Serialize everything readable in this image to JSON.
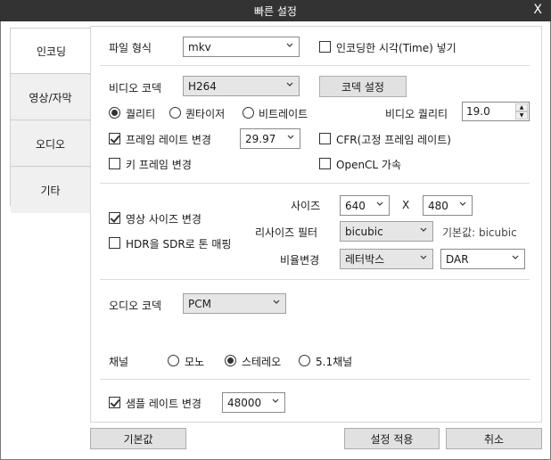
{
  "window": {
    "title": "빠른 설정",
    "close": "X"
  },
  "sidebar": {
    "items": [
      {
        "label": "인코딩"
      },
      {
        "label": "영상/자막"
      },
      {
        "label": "오디오"
      },
      {
        "label": "기타"
      }
    ]
  },
  "encoding": {
    "file_format_label": "파일 형식",
    "file_format_value": "mkv",
    "insert_time_label": "인코딩한 시각(Time) 넣기",
    "insert_time_checked": false
  },
  "video": {
    "codec_label": "비디오 코덱",
    "codec_value": "H264",
    "codec_settings_button": "코덱 설정",
    "rate_modes": [
      {
        "label": "퀄리티",
        "selected": true
      },
      {
        "label": "퀀타이저",
        "selected": false
      },
      {
        "label": "비트레이트",
        "selected": false
      }
    ],
    "quality_label": "비디오 퀄리티",
    "quality_value": "19.0",
    "framerate_change_label": "프레임 레이트 변경",
    "framerate_change_checked": true,
    "framerate_value": "29.97",
    "cfr_label": "CFR(고정 프레임 레이트)",
    "cfr_checked": false,
    "keyframe_change_label": "키 프레임 변경",
    "keyframe_change_checked": false,
    "opencl_label": "OpenCL 가속",
    "opencl_checked": false
  },
  "size": {
    "size_label": "사이즈",
    "width_value": "640",
    "x_label": "X",
    "height_value": "480",
    "resize_video_label": "영상 사이즈 변경",
    "resize_video_checked": true,
    "hdr_label": "HDR을 SDR로 톤 매핑",
    "hdr_checked": false,
    "resize_filter_label": "리사이즈 필터",
    "resize_filter_value": "bicubic",
    "default_hint": "기본값: bicubic",
    "ratio_label": "비율변경",
    "ratio_value": "레터박스",
    "aspect_value": "DAR"
  },
  "audio": {
    "codec_label": "오디오 코덱",
    "codec_value": "PCM",
    "channel_label": "채널",
    "channels": [
      {
        "label": "모노",
        "selected": false
      },
      {
        "label": "스테레오",
        "selected": true
      },
      {
        "label": "5.1채널",
        "selected": false
      }
    ],
    "samplerate_change_label": "샘플 레이트 변경",
    "samplerate_change_checked": true,
    "samplerate_value": "48000"
  },
  "footer": {
    "default_button": "기본값",
    "apply_button": "설정 적용",
    "cancel_button": "취소"
  }
}
